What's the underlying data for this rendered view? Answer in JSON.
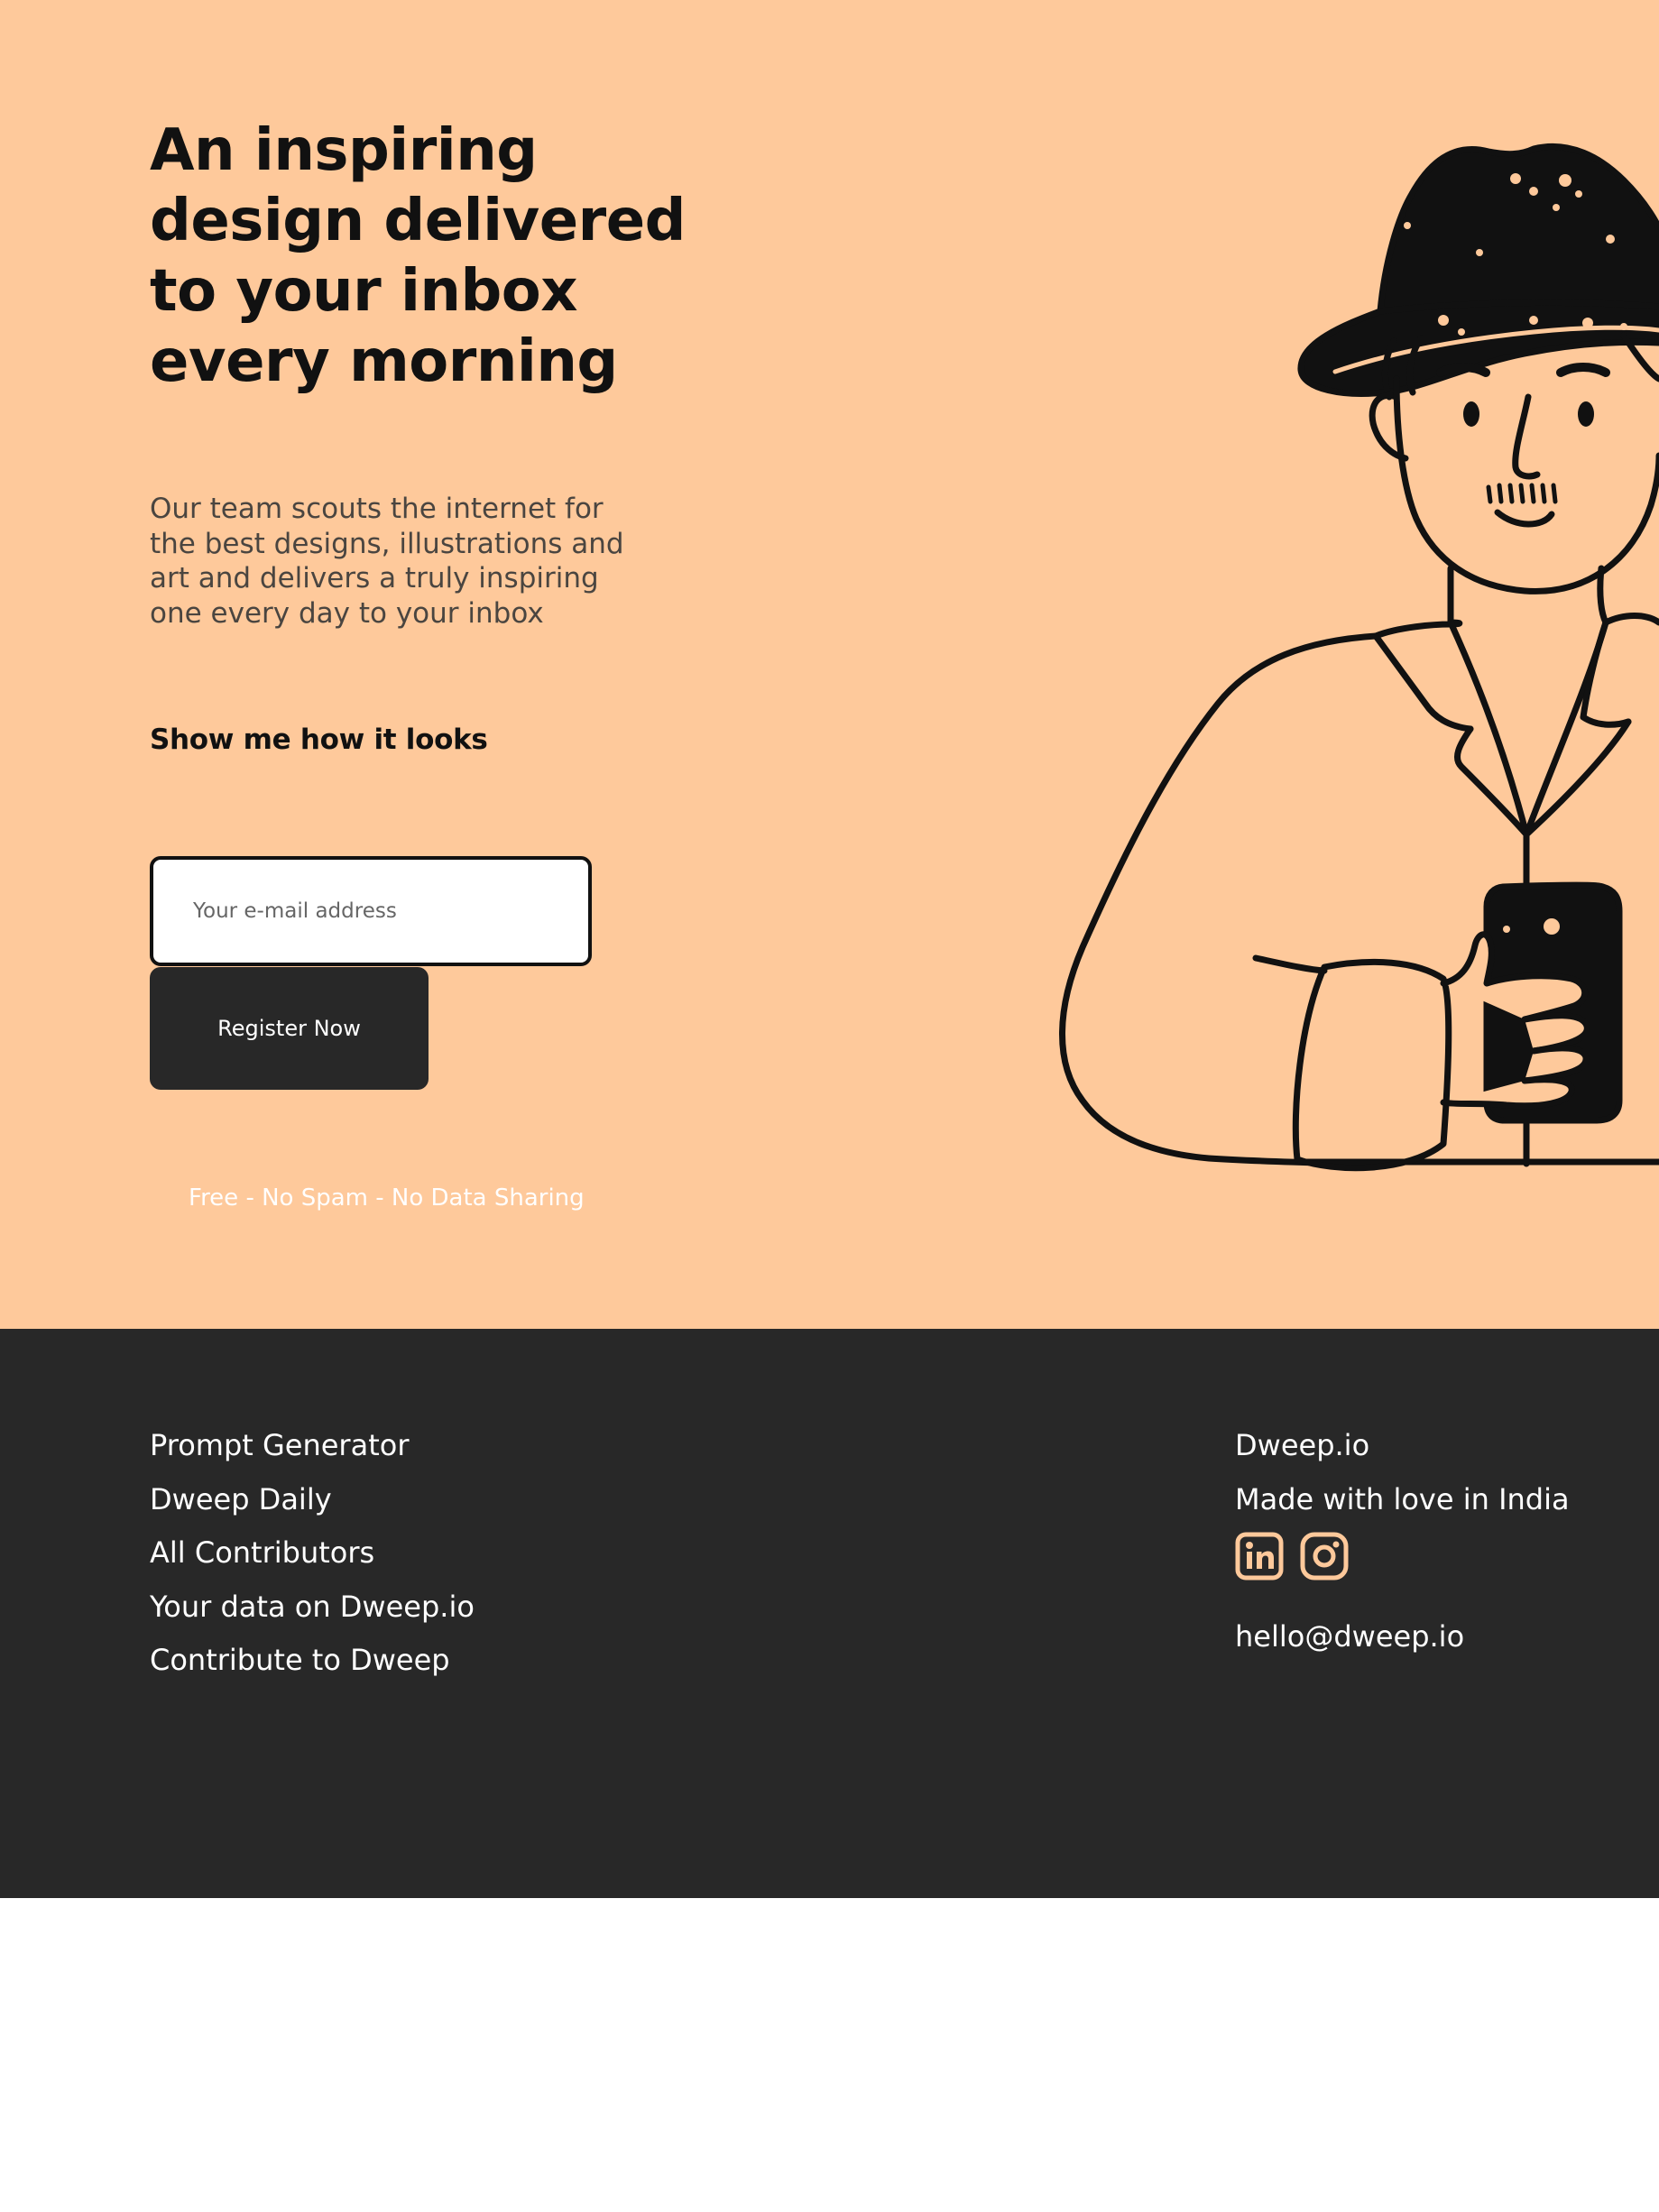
{
  "hero": {
    "headline": "An inspiring design delivered to your inbox every morning",
    "subtext": "Our team scouts the internet for the best designs, illustrations and art and delivers a truly inspiring one every day to your inbox",
    "show_link": "Show me how it looks",
    "email_placeholder": "Your e-mail address",
    "register_label": "Register Now",
    "fineprint": "Free - No Spam - No Data Sharing",
    "illustration_icon": "person-with-hat-holding-phone-illustration"
  },
  "footer": {
    "links": [
      "Prompt Generator",
      "Dweep Daily",
      "All Contributors",
      "Your data on Dweep.io",
      "Contribute to Dweep"
    ],
    "brand": "Dweep.io",
    "tagline": "Made with love in India",
    "social_icons": [
      "linkedin-icon",
      "instagram-icon"
    ],
    "email": "hello@dweep.io"
  },
  "colors": {
    "hero_bg": "#FEC99B",
    "footer_bg": "#282828",
    "button_bg": "#282828",
    "page_bg": "#FFFFFF"
  }
}
